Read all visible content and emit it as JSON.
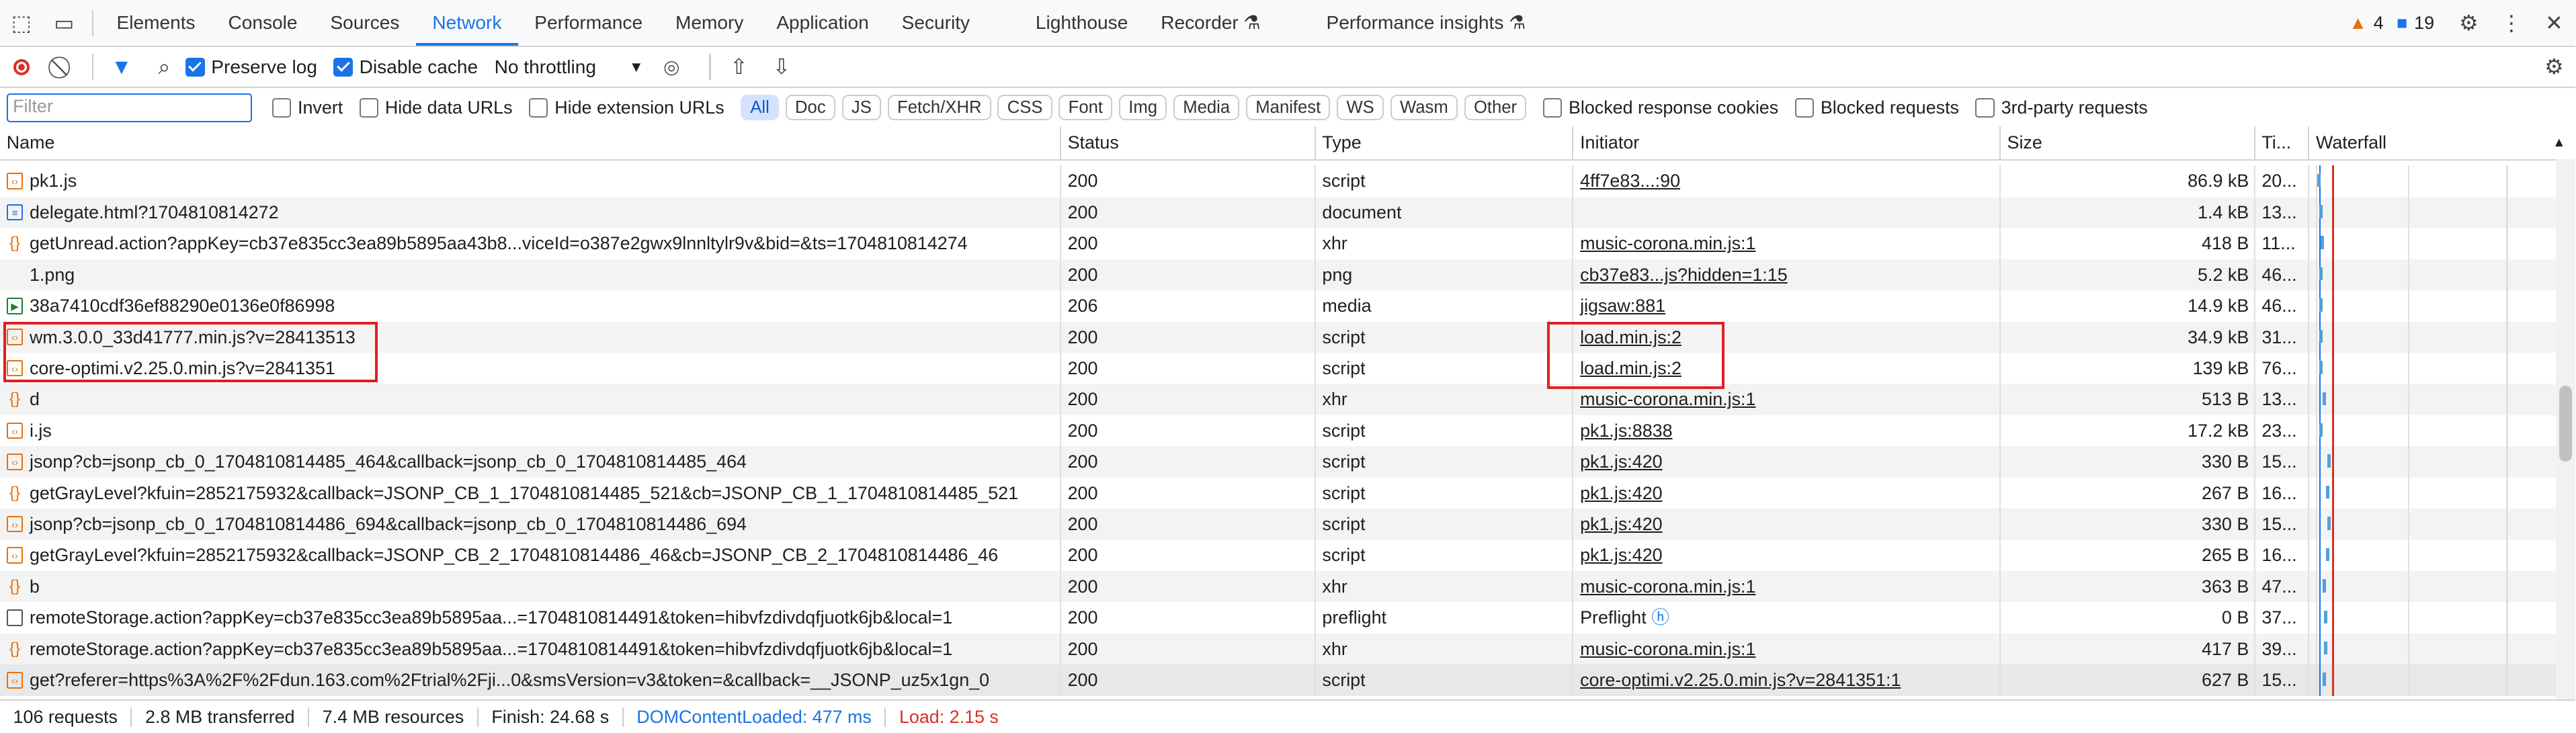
{
  "tabs": [
    "Elements",
    "Console",
    "Sources",
    "Network",
    "Performance",
    "Memory",
    "Application",
    "Security",
    "Lighthouse",
    "Recorder",
    "Performance insights"
  ],
  "badges": {
    "warnings": "4",
    "messages": "19"
  },
  "toolbar": {
    "preserve_log": "Preserve log",
    "disable_cache": "Disable cache",
    "throttling": "No throttling"
  },
  "filter": {
    "placeholder": "Filter",
    "invert": "Invert",
    "hide_data_urls": "Hide data URLs",
    "hide_ext_urls": "Hide extension URLs",
    "chips": [
      "All",
      "Doc",
      "JS",
      "Fetch/XHR",
      "CSS",
      "Font",
      "Img",
      "Media",
      "Manifest",
      "WS",
      "Wasm",
      "Other"
    ],
    "blocked_cookies": "Blocked response cookies",
    "blocked_requests": "Blocked requests",
    "third_party": "3rd-party requests"
  },
  "columns": {
    "name": "Name",
    "status": "Status",
    "type": "Type",
    "initiator": "Initiator",
    "size": "Size",
    "time": "Ti...",
    "waterfall": "Waterfall"
  },
  "rows": [
    {
      "icon": "script",
      "name": "pk1.js",
      "status": "200",
      "type": "script",
      "initiator": "4ff7e83...:90",
      "link": true,
      "size": "86.9 kB",
      "time": "20..."
    },
    {
      "icon": "doc",
      "name": "delegate.html?1704810814272",
      "status": "200",
      "type": "document",
      "initiator": "",
      "link": false,
      "size": "1.4 kB",
      "time": "13..."
    },
    {
      "icon": "xhr",
      "name": "getUnread.action?appKey=cb37e835cc3ea89b5895aa43b8...viceId=o387e2gwx9lnnltylr9v&bid=&ts=1704810814274",
      "status": "200",
      "type": "xhr",
      "initiator": "music-corona.min.js:1",
      "link": true,
      "size": "418 B",
      "time": "11..."
    },
    {
      "icon": "blank",
      "name": "1.png",
      "status": "200",
      "type": "png",
      "initiator": "cb37e83...js?hidden=1:15",
      "link": true,
      "size": "5.2 kB",
      "time": "46..."
    },
    {
      "icon": "media",
      "name": "38a7410cdf36ef88290e0136e0f86998",
      "status": "206",
      "type": "media",
      "initiator": "jigsaw:881",
      "link": true,
      "size": "14.9 kB",
      "time": "46..."
    },
    {
      "icon": "script",
      "name": "wm.3.0.0_33d41777.min.js?v=28413513",
      "status": "200",
      "type": "script",
      "initiator": "load.min.js:2",
      "link": true,
      "size": "34.9 kB",
      "time": "31..."
    },
    {
      "icon": "script",
      "name": "core-optimi.v2.25.0.min.js?v=2841351",
      "status": "200",
      "type": "script",
      "initiator": "load.min.js:2",
      "link": true,
      "size": "139 kB",
      "time": "76..."
    },
    {
      "icon": "xhr",
      "name": "d",
      "status": "200",
      "type": "xhr",
      "initiator": "music-corona.min.js:1",
      "link": true,
      "size": "513 B",
      "time": "13..."
    },
    {
      "icon": "script",
      "name": "i.js",
      "status": "200",
      "type": "script",
      "initiator": "pk1.js:8838",
      "link": true,
      "size": "17.2 kB",
      "time": "23..."
    },
    {
      "icon": "script",
      "name": "jsonp?cb=jsonp_cb_0_1704810814485_464&callback=jsonp_cb_0_1704810814485_464",
      "status": "200",
      "type": "script",
      "initiator": "pk1.js:420",
      "link": true,
      "size": "330 B",
      "time": "15..."
    },
    {
      "icon": "xhr",
      "name": "getGrayLevel?kfuin=2852175932&callback=JSONP_CB_1_1704810814485_521&cb=JSONP_CB_1_1704810814485_521",
      "status": "200",
      "type": "script",
      "initiator": "pk1.js:420",
      "link": true,
      "size": "267 B",
      "time": "16..."
    },
    {
      "icon": "script",
      "name": "jsonp?cb=jsonp_cb_0_1704810814486_694&callback=jsonp_cb_0_1704810814486_694",
      "status": "200",
      "type": "script",
      "initiator": "pk1.js:420",
      "link": true,
      "size": "330 B",
      "time": "15..."
    },
    {
      "icon": "script",
      "name": "getGrayLevel?kfuin=2852175932&callback=JSONP_CB_2_1704810814486_46&cb=JSONP_CB_2_1704810814486_46",
      "status": "200",
      "type": "script",
      "initiator": "pk1.js:420",
      "link": true,
      "size": "265 B",
      "time": "16..."
    },
    {
      "icon": "xhr",
      "name": "b",
      "status": "200",
      "type": "xhr",
      "initiator": "music-corona.min.js:1",
      "link": true,
      "size": "363 B",
      "time": "47..."
    },
    {
      "icon": "pre",
      "name": "remoteStorage.action?appKey=cb37e835cc3ea89b5895aa...=1704810814491&token=hibvfzdivdqfjuotk6jb&local=1",
      "status": "200",
      "type": "preflight",
      "initiator": "Preflight",
      "link": false,
      "size": "0 B",
      "time": "37..."
    },
    {
      "icon": "xhr",
      "name": "remoteStorage.action?appKey=cb37e835cc3ea89b5895aa...=1704810814491&token=hibvfzdivdqfjuotk6jb&local=1",
      "status": "200",
      "type": "xhr",
      "initiator": "music-corona.min.js:1",
      "link": true,
      "size": "417 B",
      "time": "39..."
    },
    {
      "icon": "script",
      "name": "get?referer=https%3A%2F%2Fdun.163.com%2Ftrial%2Fji...0&smsVersion=v3&token=&callback=__JSONP_uz5x1gn_0",
      "status": "200",
      "type": "script",
      "initiator": "core-optimi.v2.25.0.min.js?v=2841351:1",
      "link": true,
      "size": "627 B",
      "time": "15..."
    }
  ],
  "status": {
    "requests": "106 requests",
    "transferred": "2.8 MB transferred",
    "resources": "7.4 MB resources",
    "finish": "Finish: 24.68 s",
    "dcl": "DOMContentLoaded: 477 ms",
    "load": "Load: 2.15 s"
  }
}
